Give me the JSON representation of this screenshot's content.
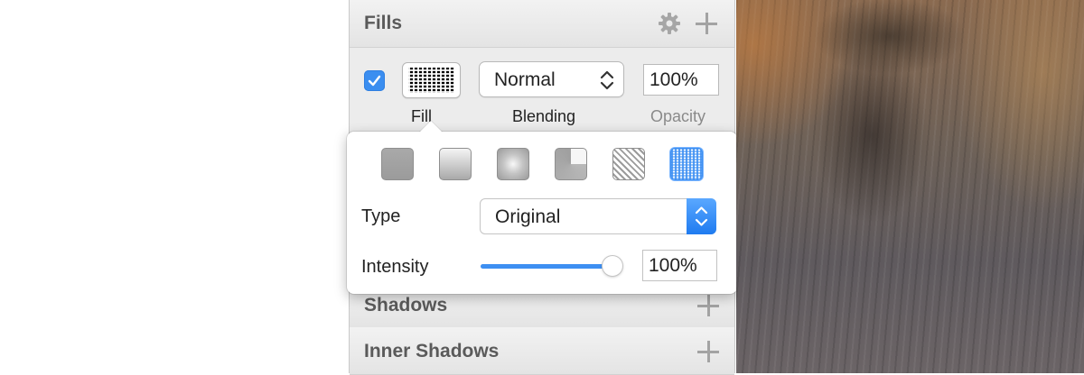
{
  "fills": {
    "title": "Fills",
    "header_icons": [
      "gear-icon",
      "plus-icon"
    ],
    "row": {
      "enabled": true,
      "fill_label": "Fill",
      "blending_value": "Normal",
      "blending_label": "Blending",
      "opacity_value": "100%",
      "opacity_label": "Opacity"
    }
  },
  "popover": {
    "fill_types": [
      "flat-color",
      "linear-gradient",
      "radial-gradient",
      "angular-gradient",
      "pattern-fill",
      "noise-fill"
    ],
    "selected_fill_type": "noise-fill",
    "type_label": "Type",
    "type_value": "Original",
    "intensity_label": "Intensity",
    "intensity_fraction": 1.0,
    "intensity_value": "100%"
  },
  "shadows": {
    "title": "Shadows"
  },
  "inner_shadows": {
    "title": "Inner Shadows"
  },
  "colors": {
    "accent": "#3b8ef0",
    "section_title": "#5a5a5a",
    "panel_bg": "#ececec"
  }
}
